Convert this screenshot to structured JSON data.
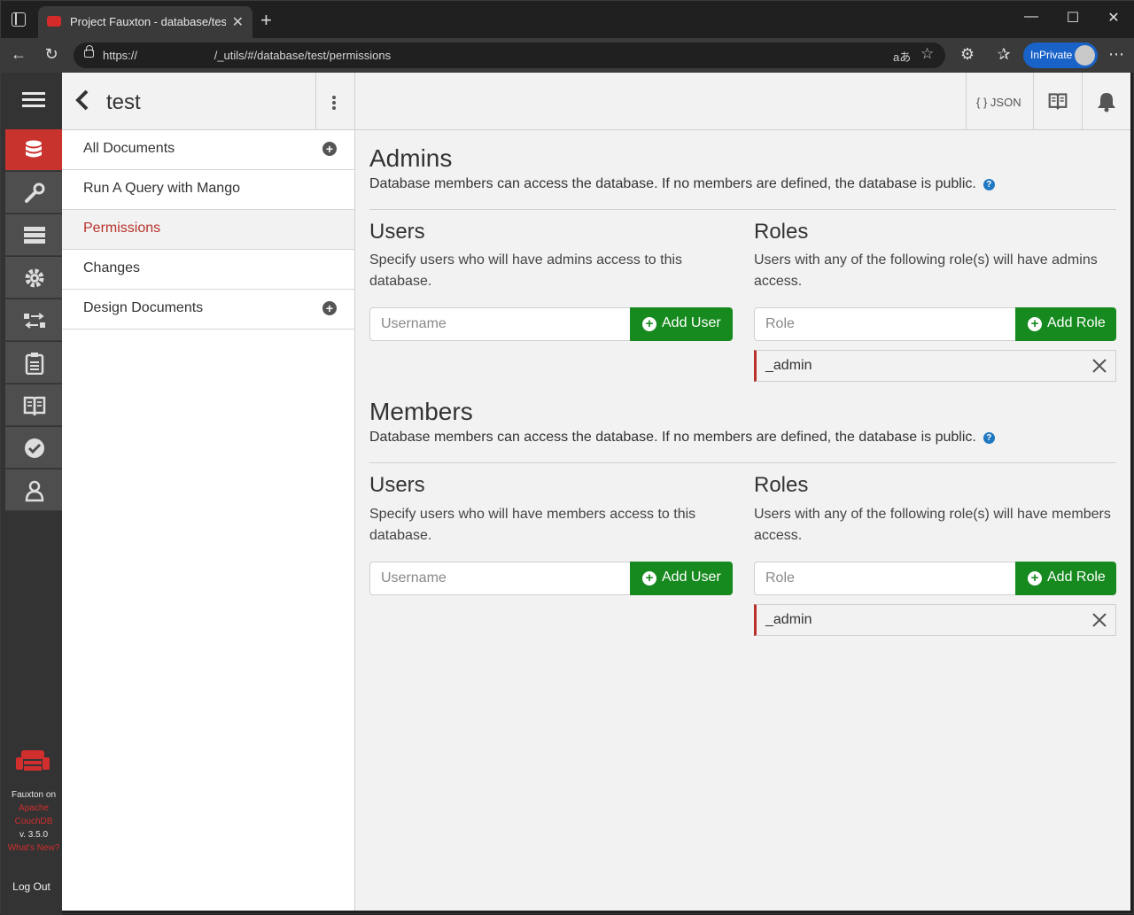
{
  "browser": {
    "tab_title": "Project Fauxton - database/test/permissions",
    "url": "https://                        /_utils/#/database/test/permissions",
    "inprivate_label": "InPrivate"
  },
  "header": {
    "db_name": "test",
    "json_label": "{ } JSON"
  },
  "sidebar": {
    "items": [
      {
        "label": "All Documents"
      },
      {
        "label": "Run A Query with Mango"
      },
      {
        "label": "Permissions"
      },
      {
        "label": "Changes"
      },
      {
        "label": "Design Documents"
      }
    ]
  },
  "brand": {
    "line1": "Fauxton on",
    "line2": "Apache",
    "line3": "CouchDB",
    "version": "v. 3.5.0",
    "whats_new": "What's New?",
    "logout": "Log Out"
  },
  "admins": {
    "title": "Admins",
    "description": "Database members can access the database. If no members are defined, the database is public.",
    "users_title": "Users",
    "users_desc": "Specify users who will have admins access to this database.",
    "username_placeholder": "Username",
    "add_user_label": "Add User",
    "roles_title": "Roles",
    "roles_desc": "Users with any of the following role(s) will have admins access.",
    "role_placeholder": "Role",
    "add_role_label": "Add Role",
    "roles": [
      "_admin"
    ]
  },
  "members": {
    "title": "Members",
    "description": "Database members can access the database. If no members are defined, the database is public.",
    "users_title": "Users",
    "users_desc": "Specify users who will have members access to this database.",
    "username_placeholder": "Username",
    "add_user_label": "Add User",
    "roles_title": "Roles",
    "roles_desc": "Users with any of the following role(s) will have members access.",
    "role_placeholder": "Role",
    "add_role_label": "Add Role",
    "roles": [
      "_admin"
    ]
  },
  "colors": {
    "accent_red": "#c9332d",
    "add_green": "#178a1f",
    "help_blue": "#1f78c1"
  }
}
